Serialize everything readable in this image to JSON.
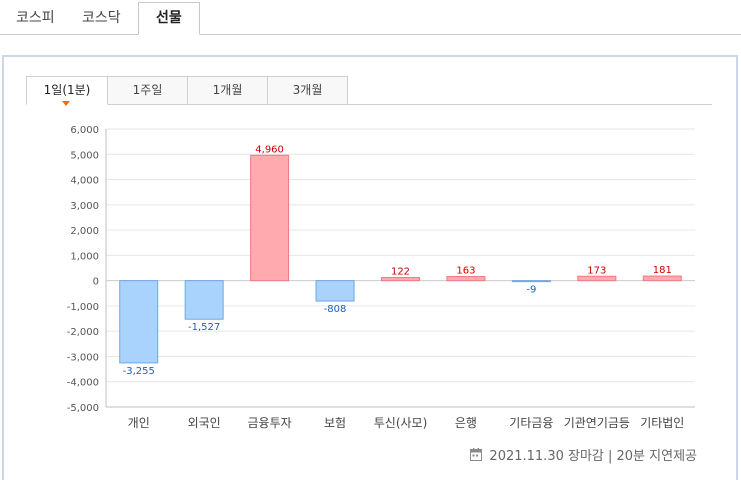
{
  "market_tabs": [
    {
      "label": "코스피",
      "active": false
    },
    {
      "label": "코스닥",
      "active": false
    },
    {
      "label": "선물",
      "active": true
    }
  ],
  "period_tabs": [
    {
      "label": "1일(1분)",
      "active": true
    },
    {
      "label": "1주일",
      "active": false
    },
    {
      "label": "1개월",
      "active": false
    },
    {
      "label": "3개월",
      "active": false
    }
  ],
  "colors": {
    "positive_fill": "#ffaaaf",
    "positive_stroke": "#f07a82",
    "positive_label": "#cc0000",
    "negative_fill": "#a9d2fc",
    "negative_stroke": "#6fa8e6",
    "negative_label": "#1a5fc2",
    "grid": "#e6e6e6"
  },
  "chart_data": {
    "type": "bar",
    "categories": [
      "개인",
      "외국인",
      "금융투자",
      "보험",
      "투신(사모)",
      "은행",
      "기타금융",
      "기관연기금등",
      "기타법인"
    ],
    "values": [
      -3255,
      -1527,
      4960,
      -808,
      122,
      163,
      -9,
      173,
      181
    ],
    "value_labels": [
      "-3,255",
      "-1,527",
      "4,960",
      "-808",
      "122",
      "163",
      "-9",
      "173",
      "181"
    ],
    "ylim": [
      -5000,
      6000
    ],
    "yticks": [
      6000,
      5000,
      4000,
      3000,
      2000,
      1000,
      0,
      -1000,
      -2000,
      -3000,
      -4000,
      -5000
    ],
    "ytick_labels": [
      "6,000",
      "5,000",
      "4,000",
      "3,000",
      "2,000",
      "1,000",
      "0",
      "-1,000",
      "-2,000",
      "-3,000",
      "-4,000",
      "-5,000"
    ],
    "grid": true
  },
  "footer": {
    "icon": "calendar-icon",
    "text": "2021.11.30 장마감 | 20분 지연제공"
  }
}
